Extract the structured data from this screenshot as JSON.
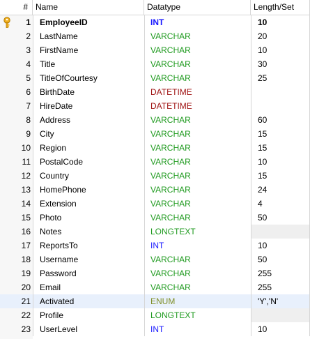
{
  "headers": {
    "num": "#",
    "name": "Name",
    "datatype": "Datatype",
    "length": "Length/Set"
  },
  "colors": {
    "INT": "#1a1aff",
    "VARCHAR": "#1f9a1f",
    "DATETIME": "#a01616",
    "LONGTEXT": "#1f9a1f",
    "ENUM": "#7f8f2a"
  },
  "rows": [
    {
      "num": "1",
      "name": "EmployeeID",
      "type": "INT",
      "length": "10",
      "primary_key": true
    },
    {
      "num": "2",
      "name": "LastName",
      "type": "VARCHAR",
      "length": "20"
    },
    {
      "num": "3",
      "name": "FirstName",
      "type": "VARCHAR",
      "length": "10"
    },
    {
      "num": "4",
      "name": "Title",
      "type": "VARCHAR",
      "length": "30"
    },
    {
      "num": "5",
      "name": "TitleOfCourtesy",
      "type": "VARCHAR",
      "length": "25"
    },
    {
      "num": "6",
      "name": "BirthDate",
      "type": "DATETIME",
      "length": ""
    },
    {
      "num": "7",
      "name": "HireDate",
      "type": "DATETIME",
      "length": ""
    },
    {
      "num": "8",
      "name": "Address",
      "type": "VARCHAR",
      "length": "60"
    },
    {
      "num": "9",
      "name": "City",
      "type": "VARCHAR",
      "length": "15"
    },
    {
      "num": "10",
      "name": "Region",
      "type": "VARCHAR",
      "length": "15"
    },
    {
      "num": "11",
      "name": "PostalCode",
      "type": "VARCHAR",
      "length": "10"
    },
    {
      "num": "12",
      "name": "Country",
      "type": "VARCHAR",
      "length": "15"
    },
    {
      "num": "13",
      "name": "HomePhone",
      "type": "VARCHAR",
      "length": "24"
    },
    {
      "num": "14",
      "name": "Extension",
      "type": "VARCHAR",
      "length": "4"
    },
    {
      "num": "15",
      "name": "Photo",
      "type": "VARCHAR",
      "length": "50"
    },
    {
      "num": "16",
      "name": "Notes",
      "type": "LONGTEXT",
      "length": "",
      "length_disabled": true
    },
    {
      "num": "17",
      "name": "ReportsTo",
      "type": "INT",
      "length": "10"
    },
    {
      "num": "18",
      "name": "Username",
      "type": "VARCHAR",
      "length": "50"
    },
    {
      "num": "19",
      "name": "Password",
      "type": "VARCHAR",
      "length": "255"
    },
    {
      "num": "20",
      "name": "Email",
      "type": "VARCHAR",
      "length": "255"
    },
    {
      "num": "21",
      "name": "Activated",
      "type": "ENUM",
      "length": "'Y','N'",
      "selected": true
    },
    {
      "num": "22",
      "name": "Profile",
      "type": "LONGTEXT",
      "length": "",
      "length_disabled": true
    },
    {
      "num": "23",
      "name": "UserLevel",
      "type": "INT",
      "length": "10"
    }
  ]
}
